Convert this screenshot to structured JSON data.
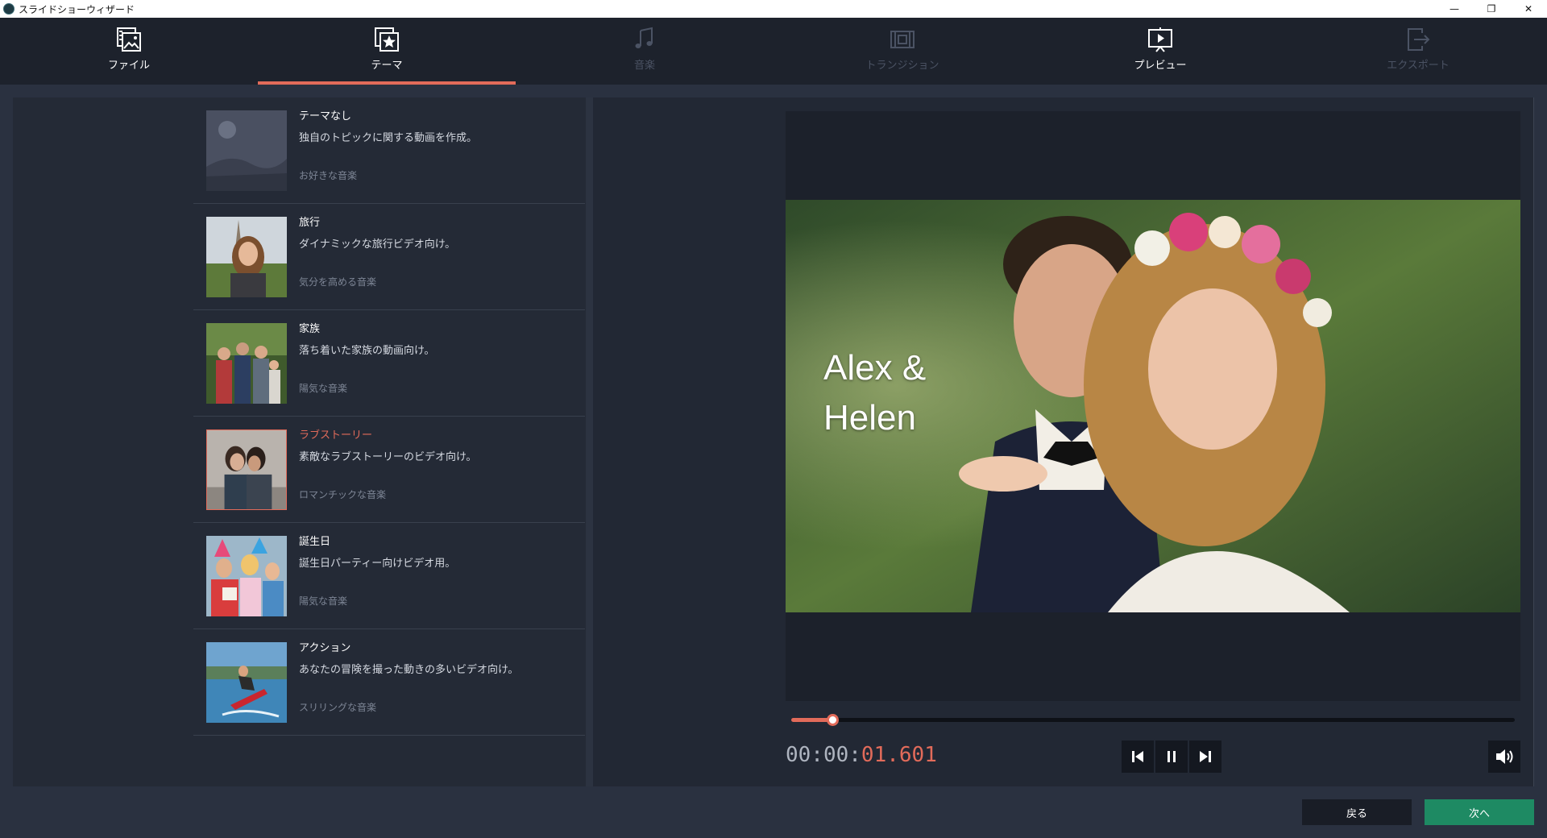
{
  "window": {
    "title": "スライドショーウィザード",
    "controls": {
      "minimize": "—",
      "restore": "❐",
      "close": "✕"
    }
  },
  "tabs": [
    {
      "label": "ファイル",
      "icon": "file-images-icon",
      "state": "enabled"
    },
    {
      "label": "テーマ",
      "icon": "theme-star-icon",
      "state": "active"
    },
    {
      "label": "音楽",
      "icon": "music-icon",
      "state": "disabled"
    },
    {
      "label": "トランジション",
      "icon": "transition-icon",
      "state": "disabled"
    },
    {
      "label": "プレビュー",
      "icon": "preview-icon",
      "state": "enabled"
    },
    {
      "label": "エクスポート",
      "icon": "export-icon",
      "state": "disabled"
    }
  ],
  "themes": [
    {
      "title": "テーマなし",
      "desc": "独自のトピックに関する動画を作成。",
      "music": "お好きな音楽",
      "selected": false
    },
    {
      "title": "旅行",
      "desc": "ダイナミックな旅行ビデオ向け。",
      "music": "気分を高める音楽",
      "selected": false
    },
    {
      "title": "家族",
      "desc": "落ち着いた家族の動画向け。",
      "music": "陽気な音楽",
      "selected": false
    },
    {
      "title": "ラブストーリー",
      "desc": "素敵なラブストーリーのビデオ向け。",
      "music": "ロマンチックな音楽",
      "selected": true
    },
    {
      "title": "誕生日",
      "desc": "誕生日パーティー向けビデオ用。",
      "music": "陽気な音楽",
      "selected": false
    },
    {
      "title": "アクション",
      "desc": "あなたの冒険を撮った動きの多いビデオ向け。",
      "music": "スリリングな音楽",
      "selected": false
    }
  ],
  "preview": {
    "title_line1": "Alex &",
    "title_line2": "Helen",
    "timecode_base": "00:00:",
    "timecode_current": "01.601",
    "progress": 0.057
  },
  "buttons": {
    "back": "戻る",
    "next": "次へ"
  },
  "colors": {
    "accent": "#e26b5a",
    "next": "#1e8a63",
    "panel": "#242a36"
  }
}
